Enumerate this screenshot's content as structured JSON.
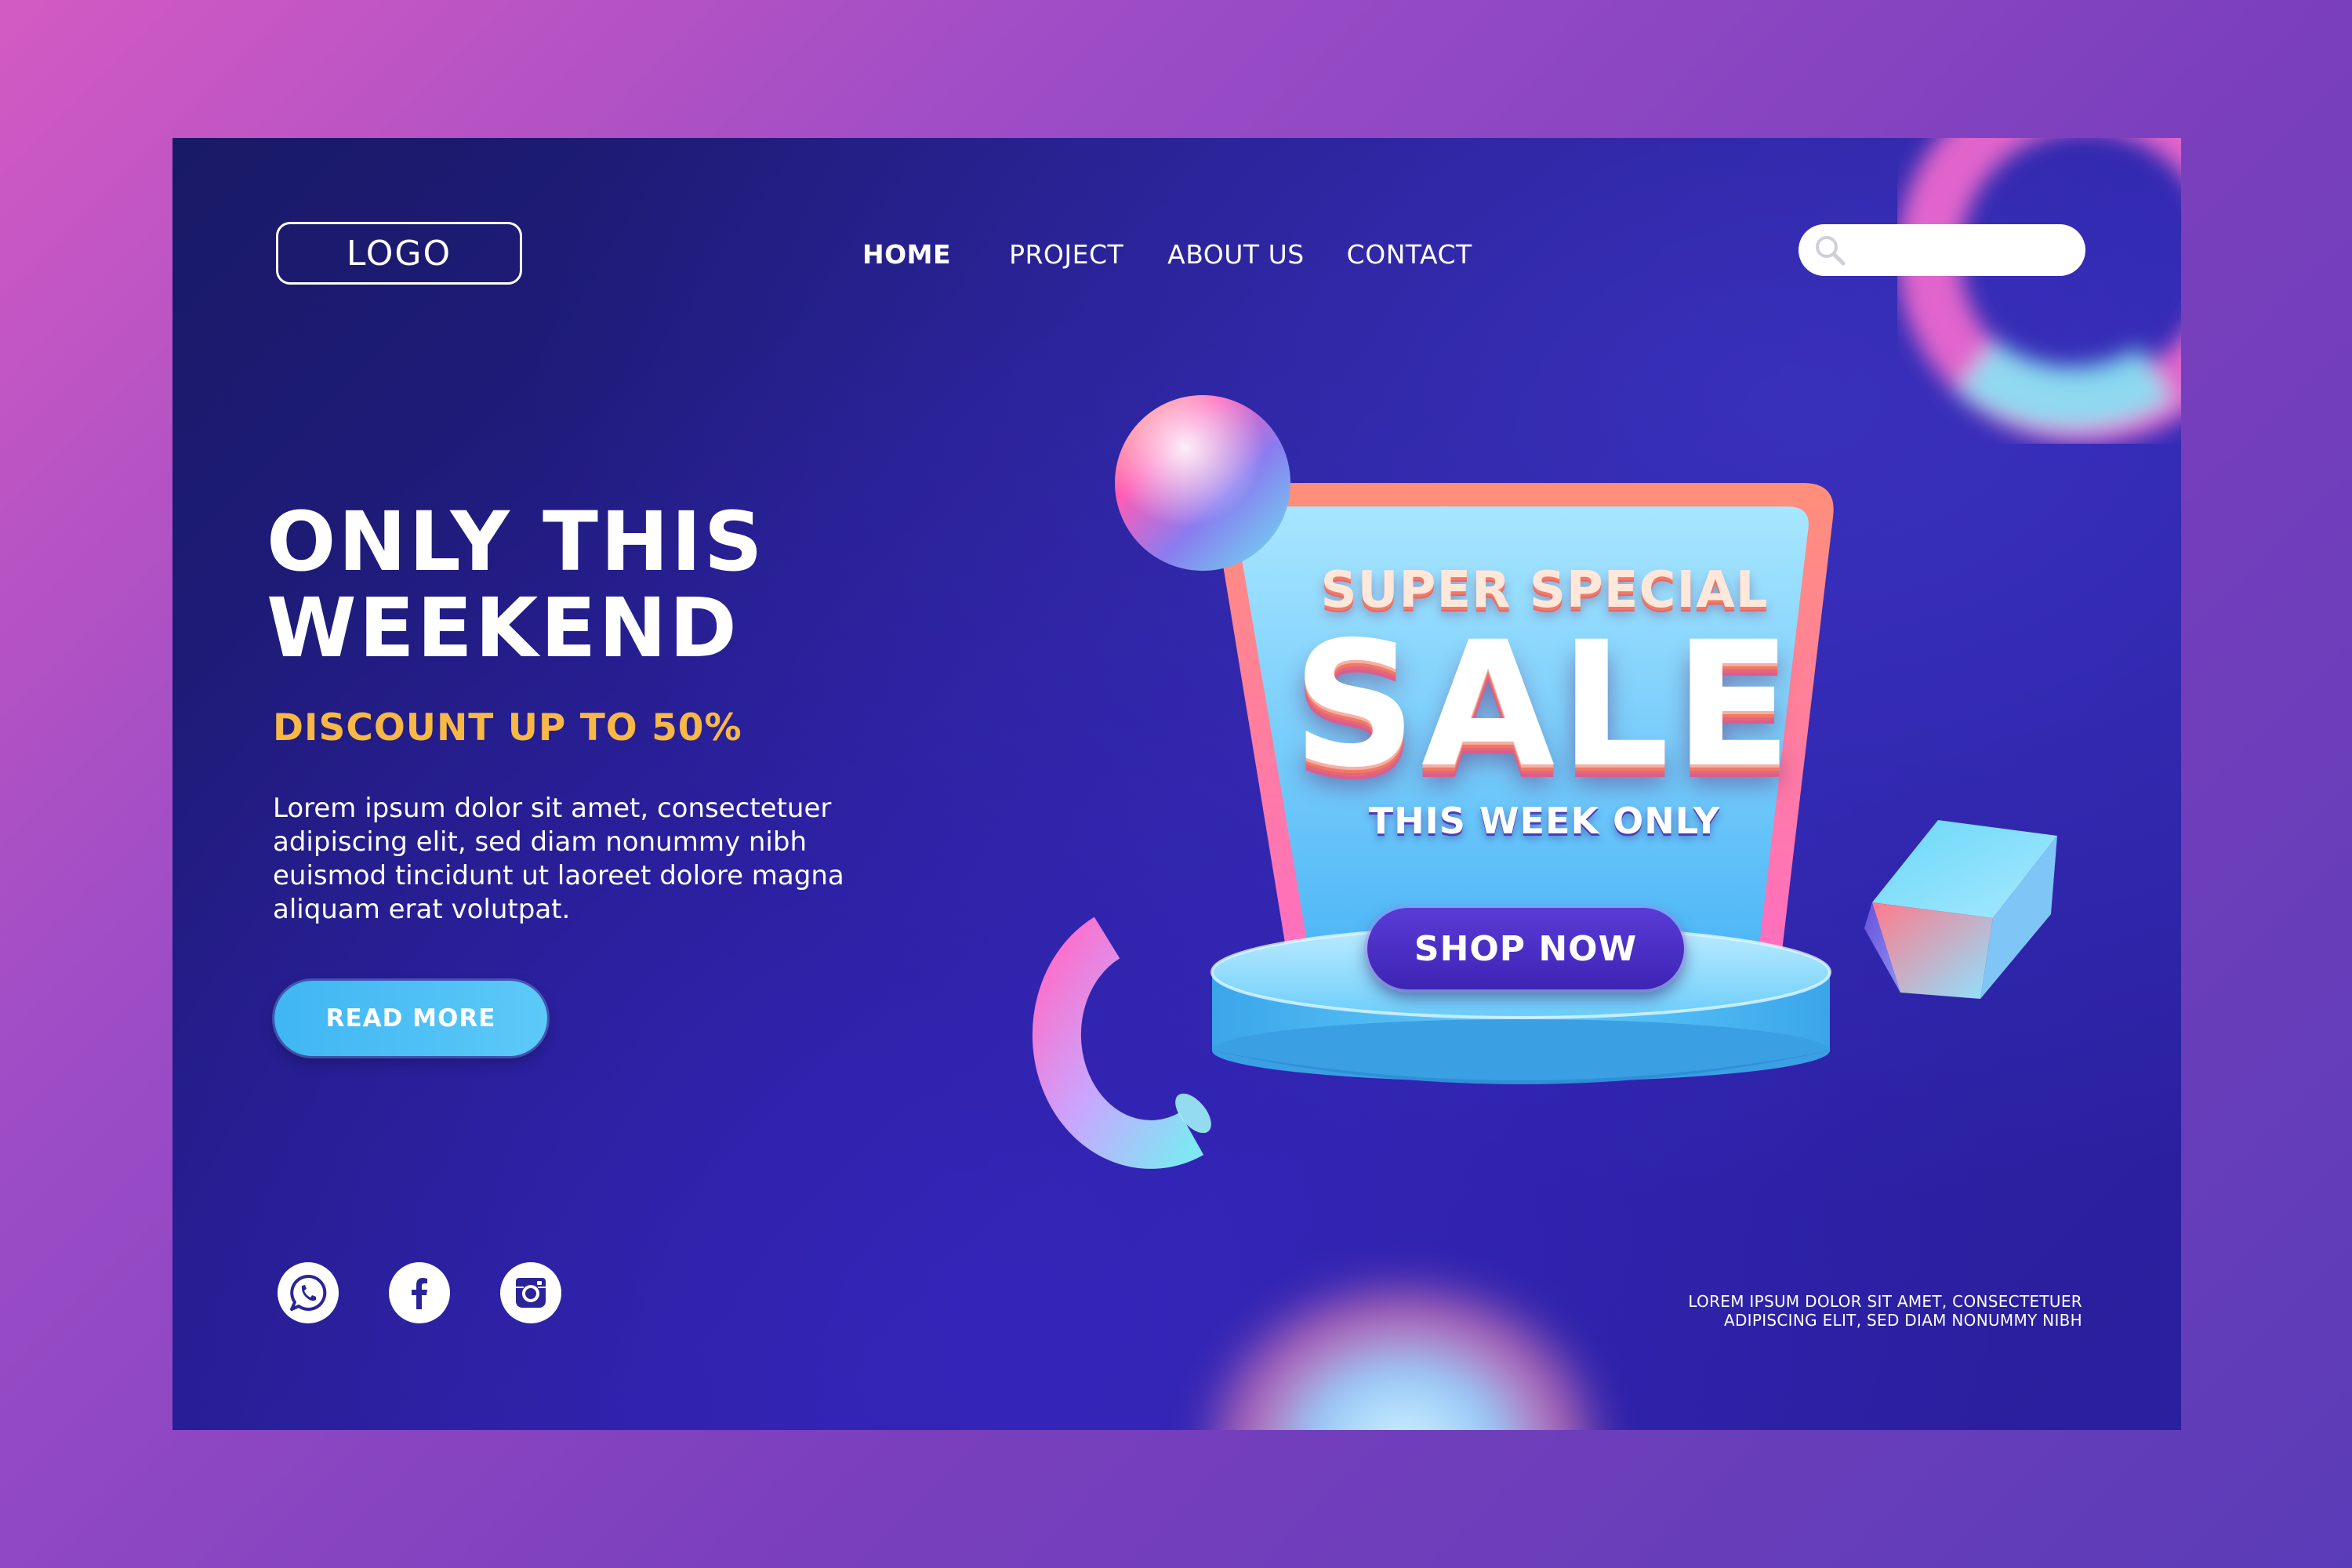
{
  "header": {
    "logo_label": "LOGO",
    "nav": [
      {
        "label": "HOME",
        "active": true
      },
      {
        "label": "PROJECT",
        "active": false
      },
      {
        "label": "ABOUT US",
        "active": false
      },
      {
        "label": "CONTACT",
        "active": false
      }
    ],
    "search": {
      "value": "",
      "placeholder": "",
      "icon": "search-icon"
    }
  },
  "hero": {
    "headline_line1": "ONLY THIS",
    "headline_line2": "WEEKEND",
    "discount": "DISCOUNT UP TO 50%",
    "body": "Lorem ipsum dolor sit amet, consectetuer adipiscing elit, sed diam nonummy nibh euismod tincidunt ut laoreet dolore magna aliquam erat volutpat.",
    "cta_label": "READ MORE"
  },
  "promo": {
    "line1": "SUPER SPECIAL",
    "line2": "SALE",
    "line3": "THIS WEEK ONLY",
    "cta_label": "SHOP NOW"
  },
  "social": [
    {
      "name": "whatsapp",
      "icon": "whatsapp-icon"
    },
    {
      "name": "facebook",
      "icon": "facebook-icon"
    },
    {
      "name": "instagram",
      "icon": "instagram-icon"
    }
  ],
  "footer": {
    "note_line1": "LOREM IPSUM DOLOR SIT AMET, CONSECTETUER",
    "note_line2": "ADIPISCING ELIT, SED DIAM NONUMMY NIBH"
  },
  "colors": {
    "frame": "#a24ec6",
    "background": "#231c8a",
    "accent_orange": "#f8b845",
    "button_blue": "#4cbef5",
    "button_purple": "#4a2fc4",
    "sale_coral": "#f07a64"
  }
}
